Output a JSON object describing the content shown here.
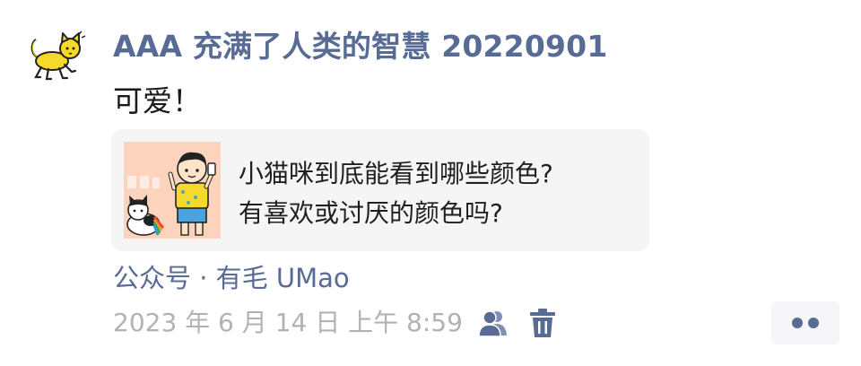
{
  "post": {
    "author": "AAA 充满了人类的智慧 20220901",
    "content": "可爱！",
    "article": {
      "title": "小猫咪到底能看到哪些颜色?\n有喜欢或讨厌的颜色吗?",
      "source": "公众号 · 有毛 UMao"
    },
    "timestamp": "2023 年 6 月 14 日  上午 8:59",
    "visibility_icon": "friends-icon",
    "delete_icon": "trash-icon",
    "more_icon": "more-dots-icon"
  },
  "colors": {
    "link": "#576b95",
    "text": "#1a1a1a",
    "muted": "#b2b2b2",
    "card_background": "#f5f5f5",
    "thumbnail_background": "#fcd3bd",
    "avatar_yellow": "#f7d92a"
  }
}
